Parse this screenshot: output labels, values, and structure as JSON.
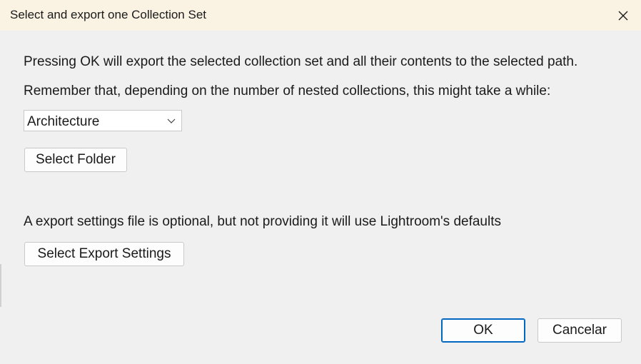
{
  "window": {
    "title": "Select and export one Collection Set",
    "close_icon": "close-icon"
  },
  "content": {
    "line1": "Pressing OK will export the selected collection set and all their contents to the selected path.",
    "line2": "Remember that, depending on the number of nested collections, this might take a while:",
    "collection_select": {
      "selected": "Architecture"
    },
    "select_folder_label": "Select Folder",
    "line3": "A export settings file is optional, but not providing it will use Lightroom's defaults",
    "select_export_settings_label": "Select Export Settings"
  },
  "footer": {
    "ok_label": "OK",
    "cancel_label": "Cancelar"
  },
  "colors": {
    "titlebar": "#faf3e3",
    "background": "#f0f0f0",
    "accent": "#0067c0"
  }
}
